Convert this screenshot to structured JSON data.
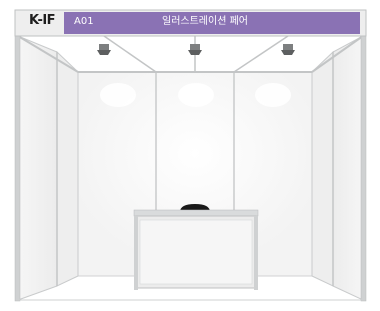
{
  "booth": {
    "logo_text": "K-IF",
    "booth_code": "A01",
    "company_name": "일러스트레이션 페어",
    "colors": {
      "fascia_band": "#8a72b4",
      "frame": "#c9cbcc",
      "panel": "#f7f7f7",
      "counter_front": "#ececec",
      "chair": "#1a1a1a"
    }
  }
}
